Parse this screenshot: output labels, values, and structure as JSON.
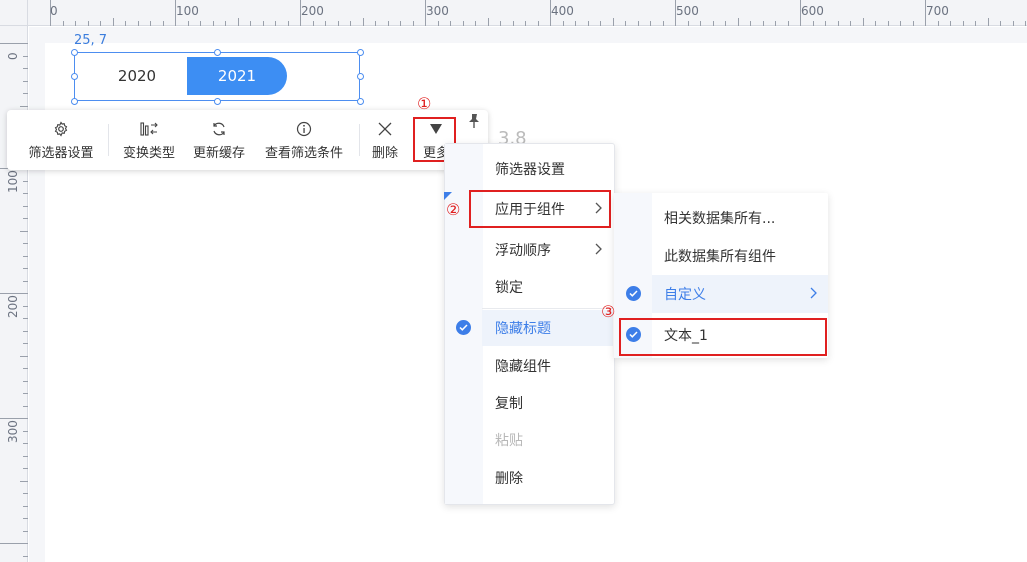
{
  "ruler": {
    "top_labels": [
      "0",
      "100",
      "200",
      "300",
      "400",
      "500",
      "600",
      "700"
    ],
    "left_labels": [
      "0",
      "100",
      "200",
      "300"
    ]
  },
  "widget": {
    "coords": "25, 7",
    "tabs": [
      {
        "label": "2020",
        "selected": false
      },
      {
        "label": "2021",
        "selected": true
      }
    ]
  },
  "toolbar": {
    "items": [
      {
        "label": "筛选器设置",
        "icon": "gear-icon"
      },
      {
        "label": "变换类型",
        "icon": "switch-type-icon"
      },
      {
        "label": "更新缓存",
        "icon": "refresh-icon"
      },
      {
        "label": "查看筛选条件",
        "icon": "info-icon"
      },
      {
        "label": "删除",
        "icon": "close-icon"
      },
      {
        "label": "更多",
        "icon": "triangle-down-icon"
      }
    ],
    "pin_icon": "pin-icon"
  },
  "annotations": [
    "①",
    "②",
    "③"
  ],
  "background_text": "3.8",
  "menu": {
    "items": [
      {
        "label": "筛选器设置"
      },
      {
        "label": "应用于组件",
        "submenu": true
      },
      {
        "label": "浮动顺序",
        "submenu": true
      },
      {
        "label": "锁定"
      },
      {
        "label": "隐藏标题",
        "checked": true,
        "active": true
      },
      {
        "label": "隐藏组件"
      },
      {
        "label": "复制"
      },
      {
        "label": "粘贴",
        "disabled": true
      },
      {
        "label": "删除"
      }
    ]
  },
  "submenu": {
    "items": [
      {
        "label": "相关数据集所有..."
      },
      {
        "label": "此数据集所有组件"
      },
      {
        "label": "自定义",
        "checked": true,
        "active": true,
        "submenu": true
      },
      {
        "label": "文本_1",
        "checked": true
      }
    ]
  },
  "colors": {
    "accent": "#3d8ef3",
    "highlight_box": "#e02020"
  }
}
